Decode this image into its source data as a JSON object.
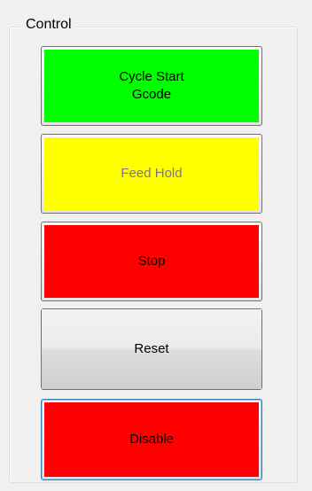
{
  "group": {
    "title": "Control"
  },
  "buttons": [
    {
      "label": "Cycle Start\nGcode",
      "color": "#00ff00"
    },
    {
      "label": "Feed Hold",
      "color": "#ffff00",
      "enabled": false
    },
    {
      "label": "Stop",
      "color": "#ff0000"
    },
    {
      "label": "Reset",
      "color": "#e0e0e0"
    },
    {
      "label": "Disable",
      "color": "#ff0000",
      "focused": true
    }
  ]
}
